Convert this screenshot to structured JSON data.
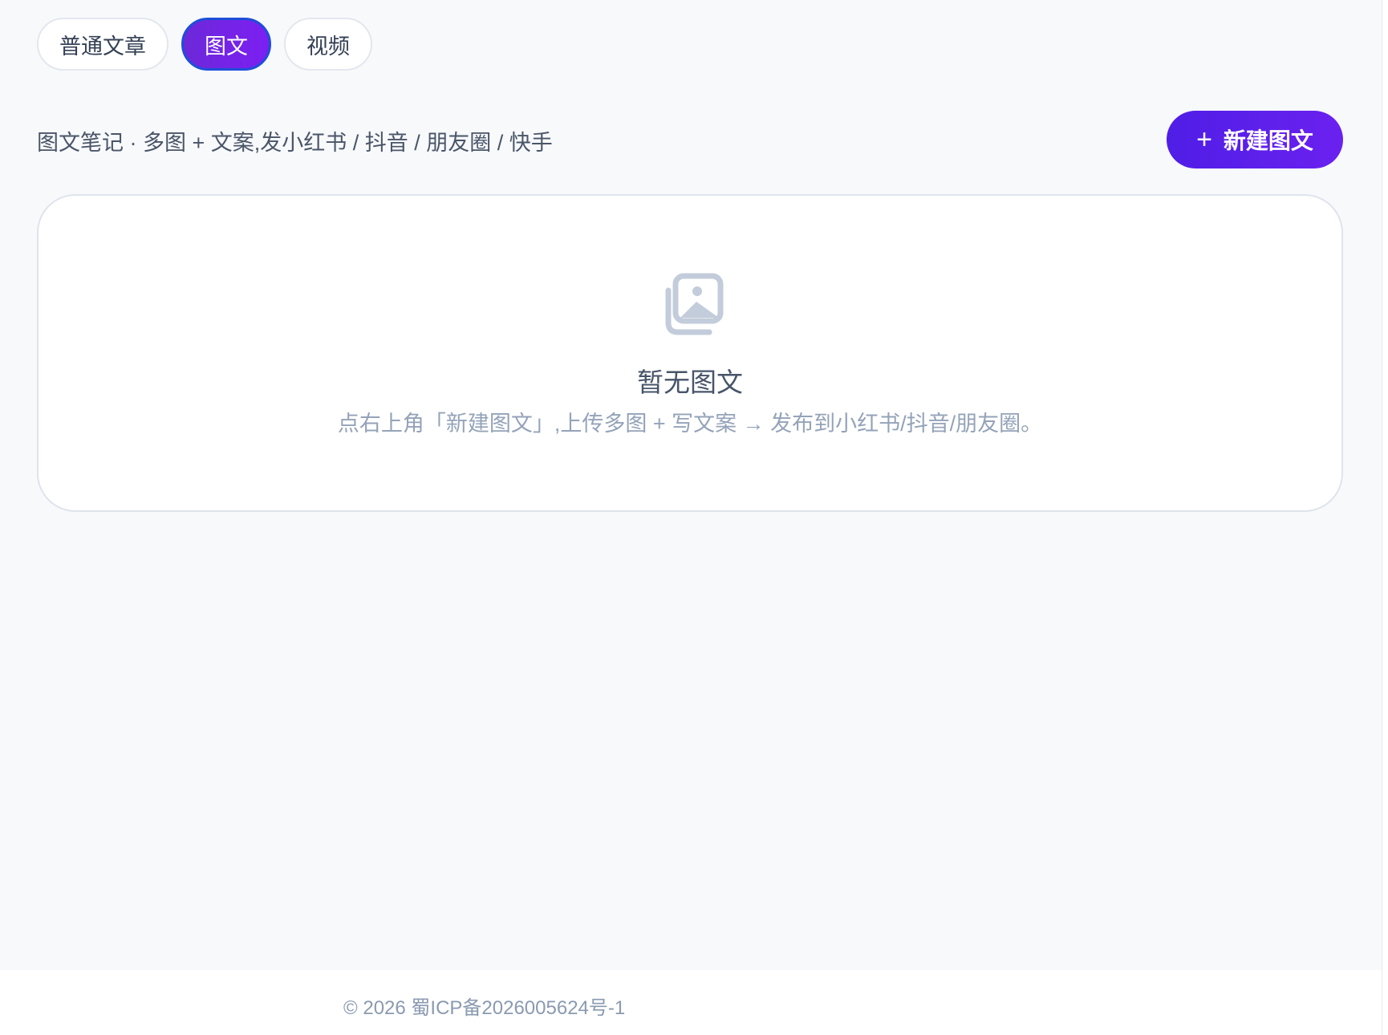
{
  "tabs": [
    {
      "label": "普通文章",
      "active": false
    },
    {
      "label": "图文",
      "active": true
    },
    {
      "label": "视频",
      "active": false
    }
  ],
  "subtitle": "图文笔记 · 多图 + 文案,发小红书 / 抖音 / 朋友圈 / 快手",
  "new_button": {
    "icon": "plus-icon",
    "label": "新建图文"
  },
  "empty_state": {
    "icon": "images-icon",
    "title": "暂无图文",
    "description": "点右上角「新建图文」,上传多图 + 写文案 → 发布到小红书/抖音/朋友圈。"
  },
  "footer": {
    "text": "© 2026 蜀ICP备2026005624号-1"
  },
  "colors": {
    "accent": "#6d28d9",
    "background": "#f7f9fb",
    "icon_muted": "#c3ccda"
  }
}
